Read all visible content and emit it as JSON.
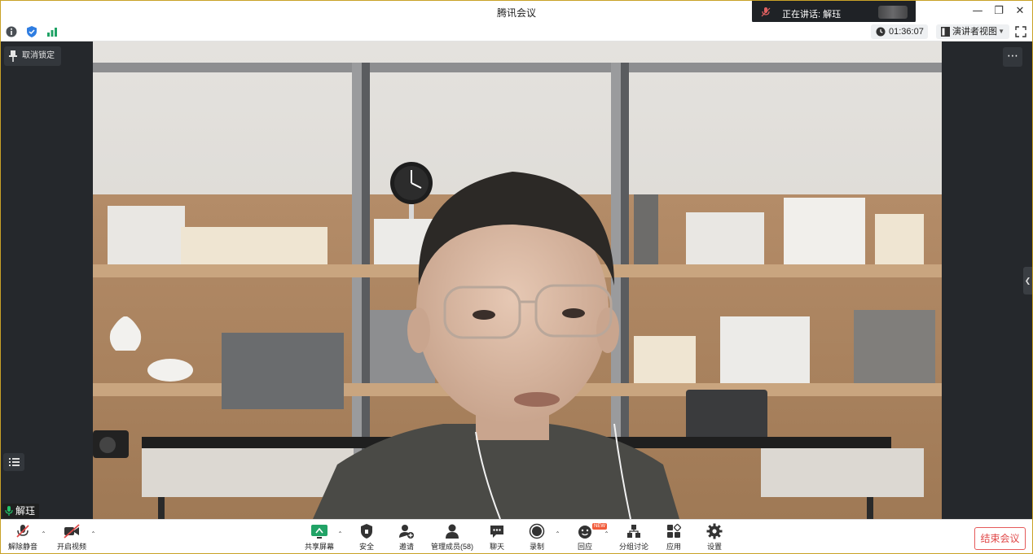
{
  "window": {
    "title": "腾讯会议"
  },
  "speaking_banner": {
    "label": "正在讲话: 解珏"
  },
  "status_bar": {
    "icons": [
      "info-icon",
      "shield-icon",
      "signal-icon"
    ],
    "timer": "01:36:07",
    "view_label": "演讲者视图"
  },
  "main": {
    "unlock_label": "取消锁定",
    "speaker_name": "解珏"
  },
  "toolbar": {
    "mute_label": "解除静音",
    "video_label": "开启视频",
    "share_label": "共享屏幕",
    "security_label": "安全",
    "invite_label": "邀请",
    "members_label": "管理成员(58)",
    "chat_label": "聊天",
    "record_label": "录制",
    "reaction_label": "回应",
    "new_badge": "NEW",
    "breakout_label": "分组讨论",
    "apps_label": "应用",
    "settings_label": "设置",
    "end_label": "结束会议"
  },
  "colors": {
    "accent_green": "#21a366",
    "end_red": "#e04848",
    "dark_bg": "#25282c"
  }
}
